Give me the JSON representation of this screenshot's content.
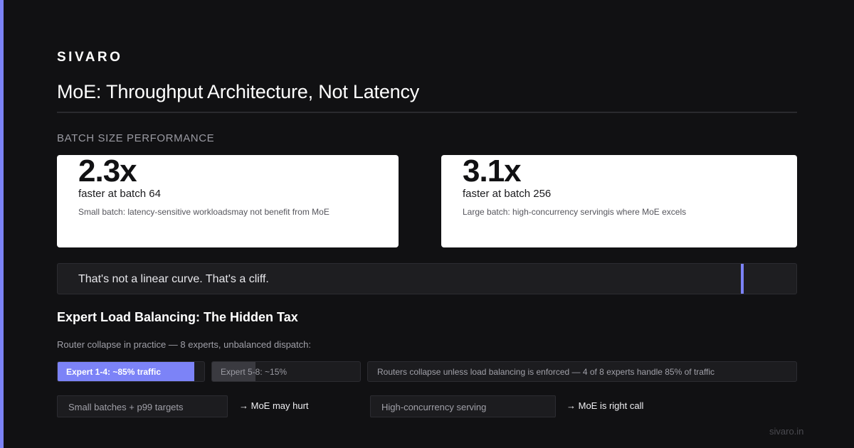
{
  "brand": "SIVARO",
  "title": "MoE: Throughput Architecture, Not Latency",
  "section_label": "BATCH SIZE PERFORMANCE",
  "cards": [
    {
      "big": "2.3x",
      "sub": "faster at batch 64",
      "note": "Small batch: latency-sensitive workloadsmay not benefit from MoE"
    },
    {
      "big": "3.1x",
      "sub": "faster at batch 256",
      "note": "Large batch: high-concurrency servingis where MoE excels"
    }
  ],
  "callout": {
    "text": "That's not a linear curve. That's a cliff."
  },
  "load_balancing": {
    "heading": "Expert Load Balancing: The Hidden Tax",
    "description": "Router collapse in practice — 8 experts, unbalanced dispatch:",
    "bars": [
      {
        "label": "Expert 1-4: ~85% traffic",
        "share": 85
      },
      {
        "label": "Expert 5-8: ~15%",
        "share": 15
      }
    ],
    "router_note": "Routers collapse unless load balancing is enforced — 4 of 8 experts handle 85% of traffic"
  },
  "decisions": [
    {
      "condition": "Small batches + p99 targets",
      "verdict": "→ MoE may hurt"
    },
    {
      "condition": "High-concurrency serving",
      "verdict": "→ MoE is right call"
    }
  ],
  "footer": "sivaro.in",
  "colors": {
    "accent": "#7c83f7",
    "background": "#111113",
    "card": "#ffffff"
  }
}
